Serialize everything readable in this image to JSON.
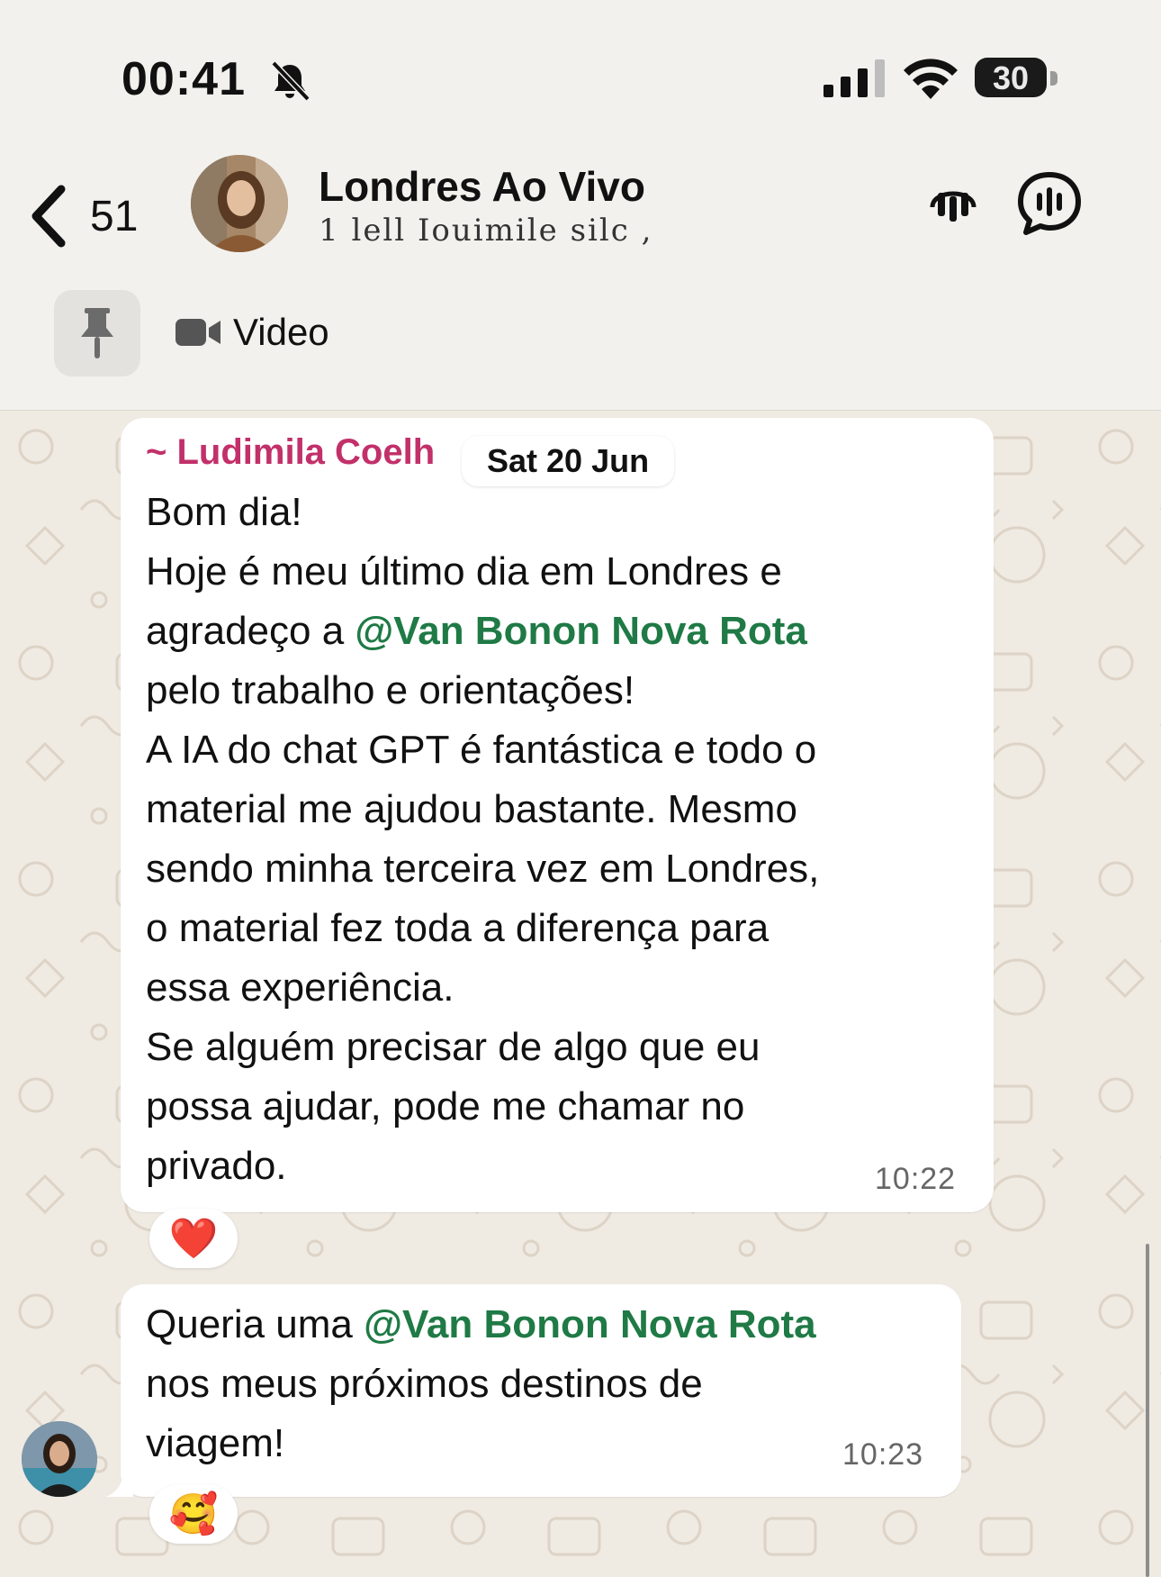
{
  "status_bar": {
    "time": "00:41",
    "battery": "30",
    "icons": [
      "bell-slash-icon",
      "cellular-signal-icon",
      "wifi-icon",
      "battery-icon"
    ]
  },
  "header": {
    "back_count": "51",
    "title": "Londres Ao Vivo",
    "subtitle": "1 lell Iouimile silc ,",
    "icons": [
      "back-chevron-icon",
      "community-icon",
      "voice-chat-icon"
    ]
  },
  "pinned": {
    "label": "Video",
    "icons": [
      "pin-icon",
      "video-camera-icon"
    ]
  },
  "messages": [
    {
      "sender": "~ Ludimila Coelh",
      "date_chip": "Sat 20 Jun",
      "lines": {
        "l1": "Bom dia!\nHoje é meu último dia em Londres e\nagradeço a ",
        "mention": "@Van Bonon Nova Rota",
        "l2": "\npelo trabalho e orientações!\nA IA do chat GPT é fantástica e todo o\nmaterial me ajudou bastante. Mesmo\nsendo minha terceira vez em Londres,\no material fez toda a diferença para\nessa experiência.\nSe alguém precisar de algo que eu\npossa ajudar, pode me chamar no\nprivado."
      },
      "time": "10:22",
      "reaction": "❤️"
    },
    {
      "lines": {
        "l1": "Queria uma ",
        "mention": "@Van Bonon Nova Rota",
        "l2": "\nnos meus próximos destinos de\nviagem!"
      },
      "time": "10:23",
      "reaction": "🥰"
    }
  ],
  "colors": {
    "sender": "#c2306a",
    "mention": "#1f7a45",
    "chat_background": "#efeae2",
    "header_background": "#f2f1ee"
  }
}
